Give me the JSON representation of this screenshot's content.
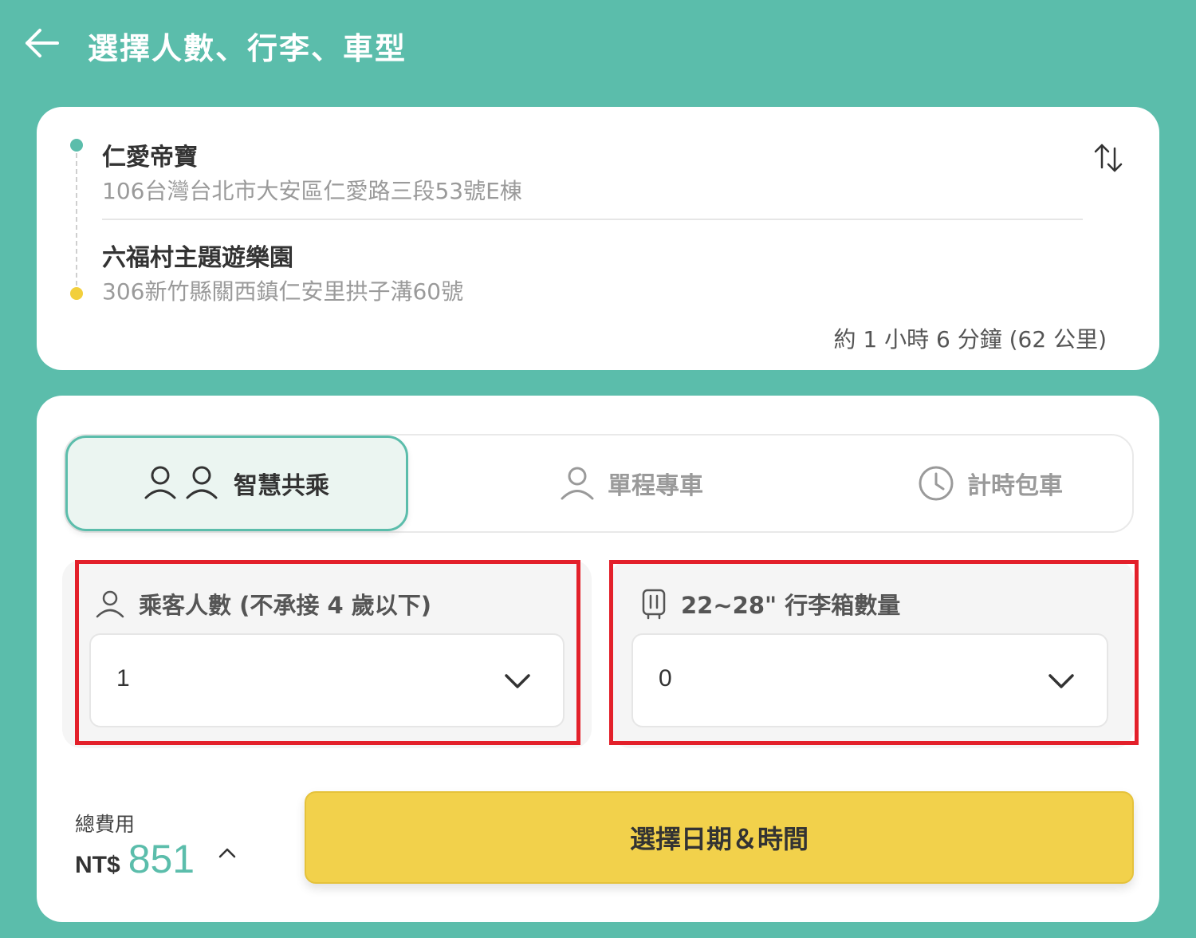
{
  "header": {
    "title": "選擇人數、行李、車型"
  },
  "route": {
    "origin": {
      "name": "仁愛帝寶",
      "address": "106台灣台北市大安區仁愛路三段53號E棟"
    },
    "destination": {
      "name": "六福村主題遊樂園",
      "address": "306新竹縣關西鎮仁安里拱子溝60號"
    },
    "summary": "約 1 小時 6 分鐘 (62 公里)"
  },
  "tabs": [
    {
      "label": "智慧共乘",
      "icon": "two-people-icon",
      "active": true
    },
    {
      "label": "單程專車",
      "icon": "person-icon",
      "active": false
    },
    {
      "label": "計時包車",
      "icon": "clock-icon",
      "active": false
    }
  ],
  "passengers": {
    "label": "乘客人數 (不承接 4 歲以下)",
    "value": "1"
  },
  "luggage": {
    "label": "22~28\" 行李箱數量",
    "value": "0"
  },
  "footer": {
    "total_label": "總費用",
    "currency": "NT$",
    "price": "851",
    "cta_label": "選擇日期＆時間"
  },
  "colors": {
    "brand": "#5bbdab",
    "accent": "#f2d14b",
    "destination_dot": "#f2cf3c",
    "highlight": "#e3202a"
  }
}
